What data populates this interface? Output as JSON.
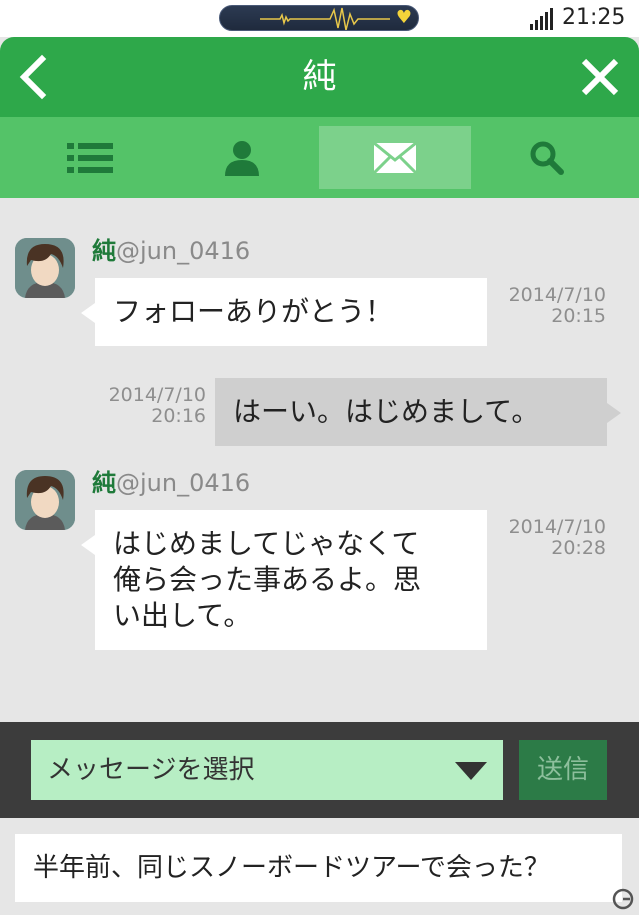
{
  "status_bar": {
    "time": "21:25"
  },
  "header": {
    "title": "純"
  },
  "tabs": [
    {
      "icon": "list-icon"
    },
    {
      "icon": "person-icon"
    },
    {
      "icon": "mail-icon",
      "active": true
    },
    {
      "icon": "search-icon"
    }
  ],
  "messages": [
    {
      "from": "other",
      "name": "純",
      "handle": "@jun_0416",
      "text": "フォローありがとう！",
      "date": "2014/7/10",
      "time": "20:15"
    },
    {
      "from": "me",
      "text": "はーい。はじめまして。",
      "date": "2014/7/10",
      "time": "20:16"
    },
    {
      "from": "other",
      "name": "純",
      "handle": "@jun_0416",
      "lines": [
        "はじめましてじゃなくて",
        "俺ら会った事あるよ。思",
        "い出して。"
      ],
      "date": "2014/7/10",
      "time": "20:28"
    }
  ],
  "composer": {
    "select_label": "メッセージを選択",
    "send_label": "送信"
  },
  "reply_option": "半年前、同じスノーボードツアーで会った？",
  "colors": {
    "header_green": "#2ea84a",
    "tab_green": "#54c368",
    "select_bg": "#b7eec4",
    "send_bg": "#2c7b47",
    "heart": "#f4d43a"
  }
}
